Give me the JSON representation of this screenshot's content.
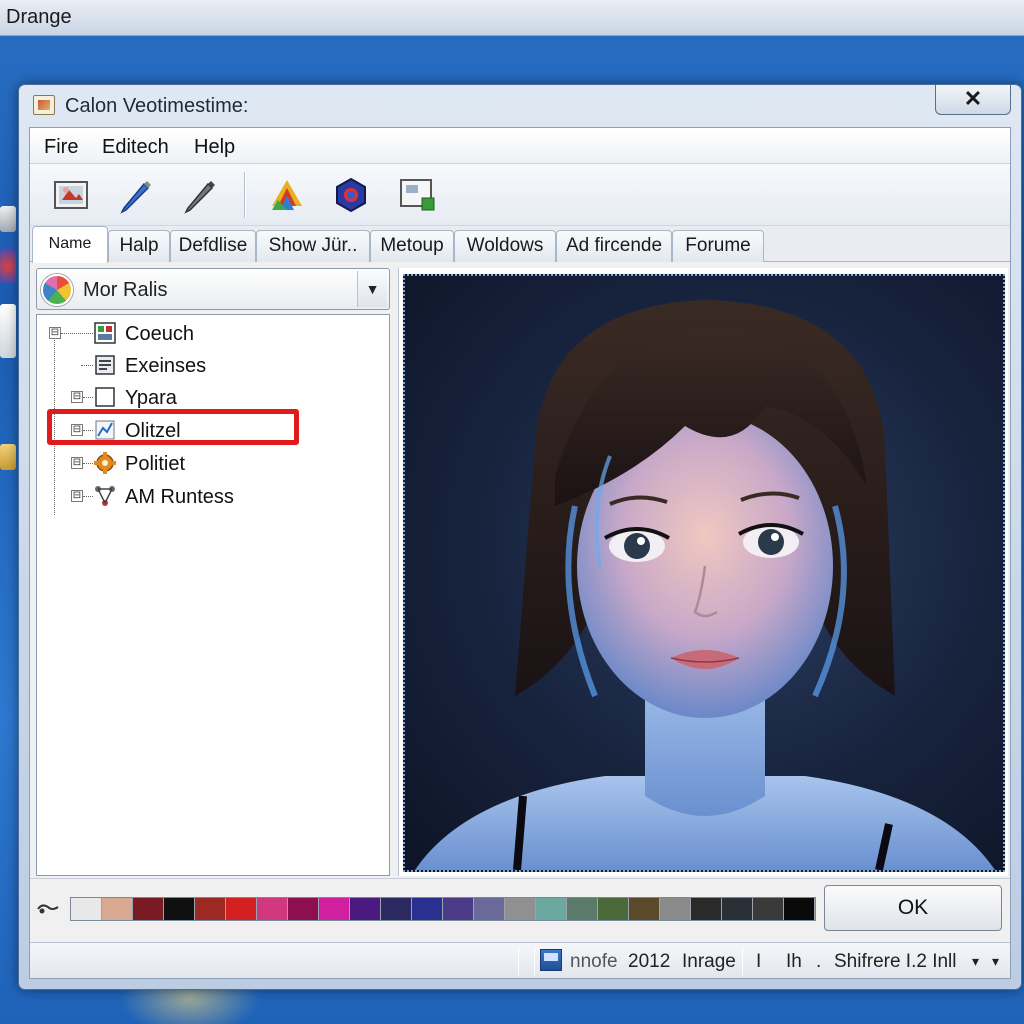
{
  "desktop": {
    "title": "Drange"
  },
  "window": {
    "title": "Calon Veotimestime:",
    "close_glyph": "✕"
  },
  "menu": {
    "items": [
      "Fire",
      "Editech",
      "Help"
    ]
  },
  "toolbar": {
    "tools": [
      "image-icon",
      "pen-icon",
      "pencil-icon",
      "shapes-icon",
      "hexagon-icon",
      "screen-icon"
    ]
  },
  "tabs": [
    "Name",
    "Halp",
    "Defdlise",
    "Show  Jür..",
    "Metoup",
    "Woldows",
    "Ad fircende",
    "Forume"
  ],
  "left_panel": {
    "combo_value": "Mor Ralis",
    "combo_arrow": "▼",
    "tree": [
      {
        "label": "Coeuch",
        "icon": "grid-icon",
        "expander": "⊟"
      },
      {
        "label": "Exeinses",
        "icon": "document-icon",
        "expander": ""
      },
      {
        "label": "Ypara",
        "icon": "frame-icon",
        "expander": "⊟"
      },
      {
        "label": "Olitzel",
        "icon": "chart-icon",
        "expander": "⊟"
      },
      {
        "label": "Politiet",
        "icon": "gear-icon",
        "expander": "⊟"
      },
      {
        "label": "AM Runtess",
        "icon": "network-icon",
        "expander": "⊟"
      }
    ],
    "selected_item": "Olitzel"
  },
  "viewer": {
    "content": "portrait-image"
  },
  "palette": {
    "colors": [
      "#e8e8e8",
      "#d8a890",
      "#7a1a22",
      "#101010",
      "#9c2a22",
      "#d42020",
      "#d03880",
      "#8c1050",
      "#d020a0",
      "#4a1a80",
      "#2a2a60",
      "#2a3090",
      "#4a3a88",
      "#6a6a9a",
      "#909090",
      "#6aa8a0",
      "#5a7a6a",
      "#4a6a3a",
      "#5a4a2a",
      "#8a8a8a",
      "#2a2a2a",
      "#2a3038",
      "#3a3a3a",
      "#0a0a0a"
    ],
    "ok_label": "OK"
  },
  "status": {
    "mode": "nnofe",
    "year": "2012",
    "kind": "Inrage",
    "cursor_glyph": "I",
    "unit": "Ih",
    "dot": ".",
    "info": "Shifrere I.2 Inll",
    "arrow_small": "▾",
    "arrow": "▾"
  }
}
